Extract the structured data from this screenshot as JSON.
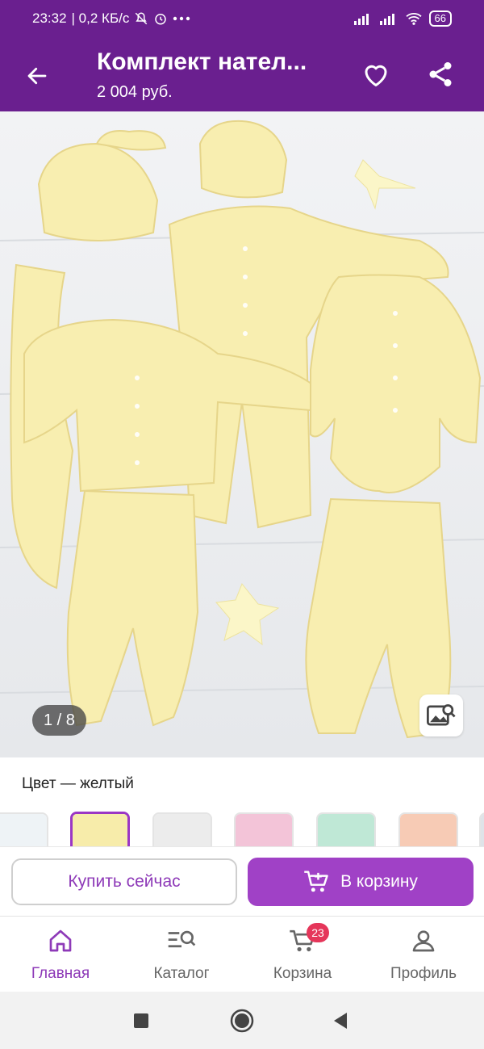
{
  "status_bar": {
    "time": "23:32",
    "speed": "| 0,2 КБ/с",
    "battery": "66"
  },
  "header": {
    "title": "Комплект нател...",
    "price": "2 004 руб."
  },
  "gallery": {
    "counter_current": "1",
    "counter_sep": " / ",
    "counter_total": "8"
  },
  "color": {
    "label": "Цвет — желтый",
    "swatches": [
      "white",
      "yellow",
      "grey",
      "pink",
      "mint",
      "peach",
      "partial"
    ],
    "selected_index": 1
  },
  "actions": {
    "buy_now": "Купить сейчас",
    "to_cart": "В корзину"
  },
  "nav": {
    "items": [
      {
        "label": "Главная",
        "icon": "home-icon"
      },
      {
        "label": "Каталог",
        "icon": "catalog-search-icon"
      },
      {
        "label": "Корзина",
        "icon": "cart-icon",
        "badge": "23"
      },
      {
        "label": "Профиль",
        "icon": "profile-icon"
      }
    ]
  },
  "colors": {
    "brand": "#6a1f8f",
    "accent": "#a041c6",
    "accent_text": "#8e3ab8",
    "badge": "#e5365a"
  }
}
